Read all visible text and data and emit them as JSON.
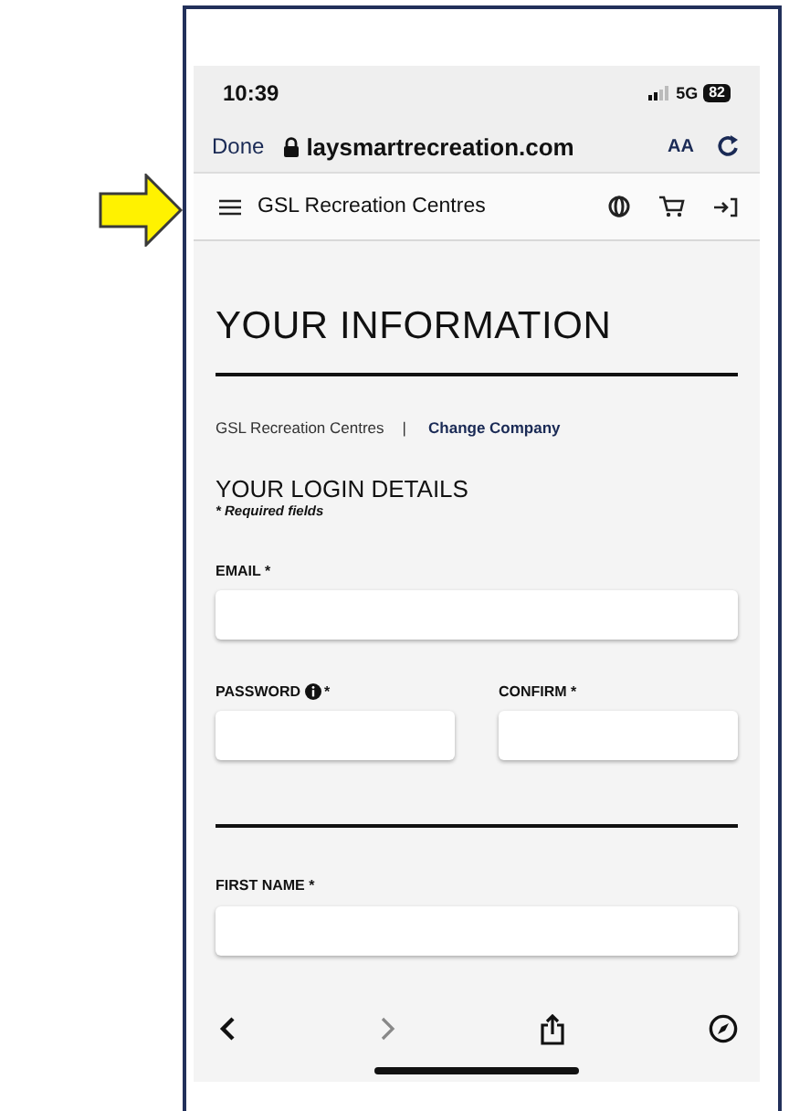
{
  "status_bar": {
    "time": "10:39",
    "network": "5G",
    "battery": "82"
  },
  "browser_bar": {
    "done": "Done",
    "url": "laysmartrecreation.com",
    "text_size": "AA"
  },
  "site_nav": {
    "title": "GSL Recreation Centres"
  },
  "page": {
    "heading": "YOUR INFORMATION",
    "company": "GSL Recreation Centres",
    "separator": "|",
    "change_link": "Change Company",
    "section": "YOUR LOGIN DETAILS",
    "required_note": "* Required fields"
  },
  "field_rows": [
    [
      {
        "label": "EMAIL *",
        "info": false
      }
    ],
    [
      {
        "label": "PASSWORD",
        "info": true,
        "suffix": "*"
      },
      {
        "label": "CONFIRM *",
        "info": false
      }
    ],
    [
      {
        "kind": "rule"
      }
    ],
    [
      {
        "label": "FIRST NAME *",
        "info": false
      }
    ]
  ],
  "toolbar": [
    {
      "kind": "back",
      "disabled": false
    },
    {
      "kind": "forward",
      "disabled": true
    },
    {
      "kind": "share",
      "disabled": false
    },
    {
      "kind": "compass",
      "disabled": false
    }
  ]
}
